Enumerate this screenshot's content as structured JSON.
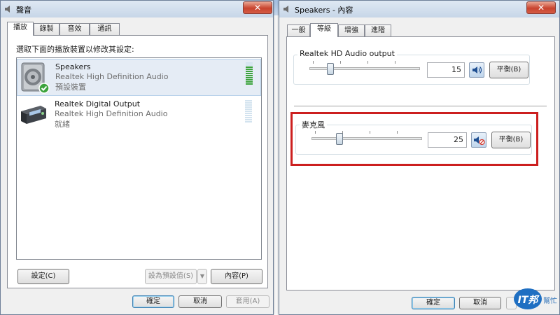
{
  "left_window": {
    "title": "聲音",
    "tabs": [
      {
        "label": "播放",
        "active": true
      },
      {
        "label": "錄製",
        "active": false
      },
      {
        "label": "音效",
        "active": false
      },
      {
        "label": "通訊",
        "active": false
      }
    ],
    "instruction": "選取下面的播放裝置以修改其設定:",
    "devices": [
      {
        "name": "Speakers",
        "driver": "Realtek High Definition Audio",
        "status": "預設裝置",
        "icon": "speaker-icon",
        "is_default": true,
        "selected": true
      },
      {
        "name": "Realtek Digital Output",
        "driver": "Realtek High Definition Audio",
        "status": "就緒",
        "icon": "digital-output-icon",
        "is_default": false,
        "selected": false
      }
    ],
    "buttons": {
      "configure": "設定(C)",
      "set_default": "設為預設值(S)",
      "properties": "內容(P)",
      "ok": "確定",
      "cancel": "取消",
      "apply": "套用(A)"
    }
  },
  "right_window": {
    "title": "Speakers - 內容",
    "tabs": [
      {
        "label": "一般",
        "active": false
      },
      {
        "label": "等級",
        "active": true
      },
      {
        "label": "增強",
        "active": false
      },
      {
        "label": "進階",
        "active": false
      }
    ],
    "levels": [
      {
        "label": "Realtek HD Audio output",
        "value": "15",
        "level": 15,
        "muted": false,
        "balance_label": "平衡(B)"
      },
      {
        "label": "麥克風",
        "value": "25",
        "level": 25,
        "muted": true,
        "balance_label": "平衡(B)"
      }
    ],
    "buttons": {
      "ok": "確定",
      "cancel": "取消"
    }
  },
  "colors": {
    "highlight": "#cc1f1f",
    "selection": "#e5ecf5",
    "meter_active": "#3ca33c",
    "meter_idle": "#d3e3ef",
    "default_check": "#3ca33c",
    "mute_indicator": "#d23a2f"
  },
  "watermark": "IT邦幫忙"
}
